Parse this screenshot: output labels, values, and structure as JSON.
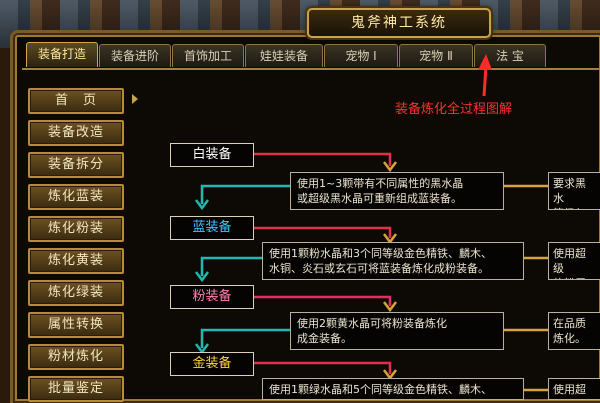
{
  "window": {
    "title": "鬼斧神工系统"
  },
  "tabs": [
    {
      "label": "装备打造",
      "active": true
    },
    {
      "label": "装备进阶",
      "active": false
    },
    {
      "label": "首饰加工",
      "active": false
    },
    {
      "label": "娃娃装备",
      "active": false
    },
    {
      "label": "宠物 Ⅰ",
      "active": false
    },
    {
      "label": "宠物 Ⅱ",
      "active": false
    },
    {
      "label": "法 宝",
      "active": false
    }
  ],
  "sidebar": {
    "items": [
      {
        "label": "首　页"
      },
      {
        "label": "装备改造"
      },
      {
        "label": "装备拆分"
      },
      {
        "label": "炼化蓝装"
      },
      {
        "label": "炼化粉装"
      },
      {
        "label": "炼化黄装"
      },
      {
        "label": "炼化绿装"
      },
      {
        "label": "属性转换"
      },
      {
        "label": "粉材炼化"
      },
      {
        "label": "批量鉴定"
      }
    ]
  },
  "annotation": {
    "text": "装备炼化全过程图解",
    "color": "#ff2a2a"
  },
  "flow": {
    "stages": [
      {
        "label": "白装备",
        "color": "#ffffff"
      },
      {
        "label": "蓝装备",
        "color": "#3ec8ff"
      },
      {
        "label": "粉装备",
        "color": "#ff7fb0"
      },
      {
        "label": "金装备",
        "color": "#ffd23a"
      }
    ],
    "notes": [
      {
        "text": "使用1~3颗带有不同属性的黑水晶\n或超级黑水晶可重新组成蓝装备。"
      },
      {
        "text": "使用1颗粉水晶和3个同等级金色精铁、麟木、\n水铜、炎石或玄石可将蓝装备炼化成粉装备。"
      },
      {
        "text": "使用2颗黄水晶可将粉装备炼化\n成金装备。"
      },
      {
        "text": "使用1颗绿水晶和5个同等级金色精铁、麟木、"
      }
    ],
    "right_notes": [
      {
        "text": "要求黑水\n等级与蓝"
      },
      {
        "text": "使用超级\n的粉属性"
      },
      {
        "text": "在品质\n炼化。"
      },
      {
        "text": "使用超\n"
      }
    ]
  },
  "colors": {
    "line_red": "#e0304a",
    "line_teal": "#20b8b0",
    "line_pink": "#e03060",
    "arrow_gold": "#d8a23a"
  }
}
